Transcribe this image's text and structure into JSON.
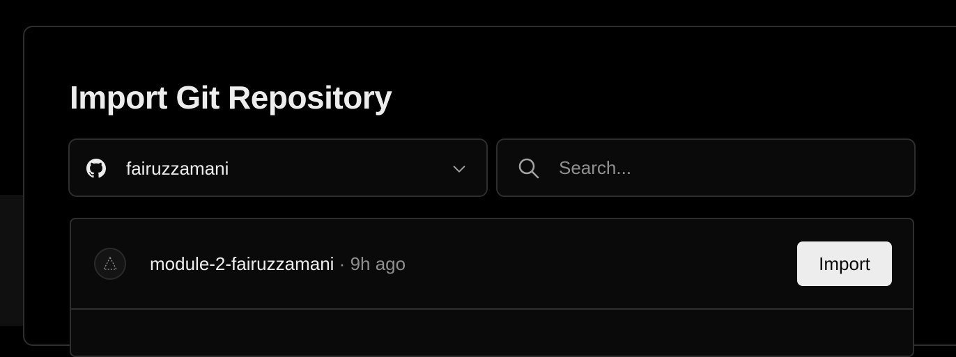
{
  "page": {
    "title": "Import Git Repository"
  },
  "scope_select": {
    "icon": "github-icon",
    "value": "fairuzzamani",
    "chevron_icon": "chevron-down-icon"
  },
  "search": {
    "icon": "search-icon",
    "placeholder": "Search..."
  },
  "repositories": [
    {
      "icon": "vercel-triangle-icon",
      "name": "module-2-fairuzzamani",
      "separator": " · ",
      "updated": "9h ago",
      "action_label": "Import"
    }
  ],
  "colors": {
    "background": "#000000",
    "surface": "#0a0a0a",
    "border": "#2e2e2e",
    "text": "#ededed",
    "muted": "#8f8f8f",
    "button_bg": "#ededed"
  }
}
